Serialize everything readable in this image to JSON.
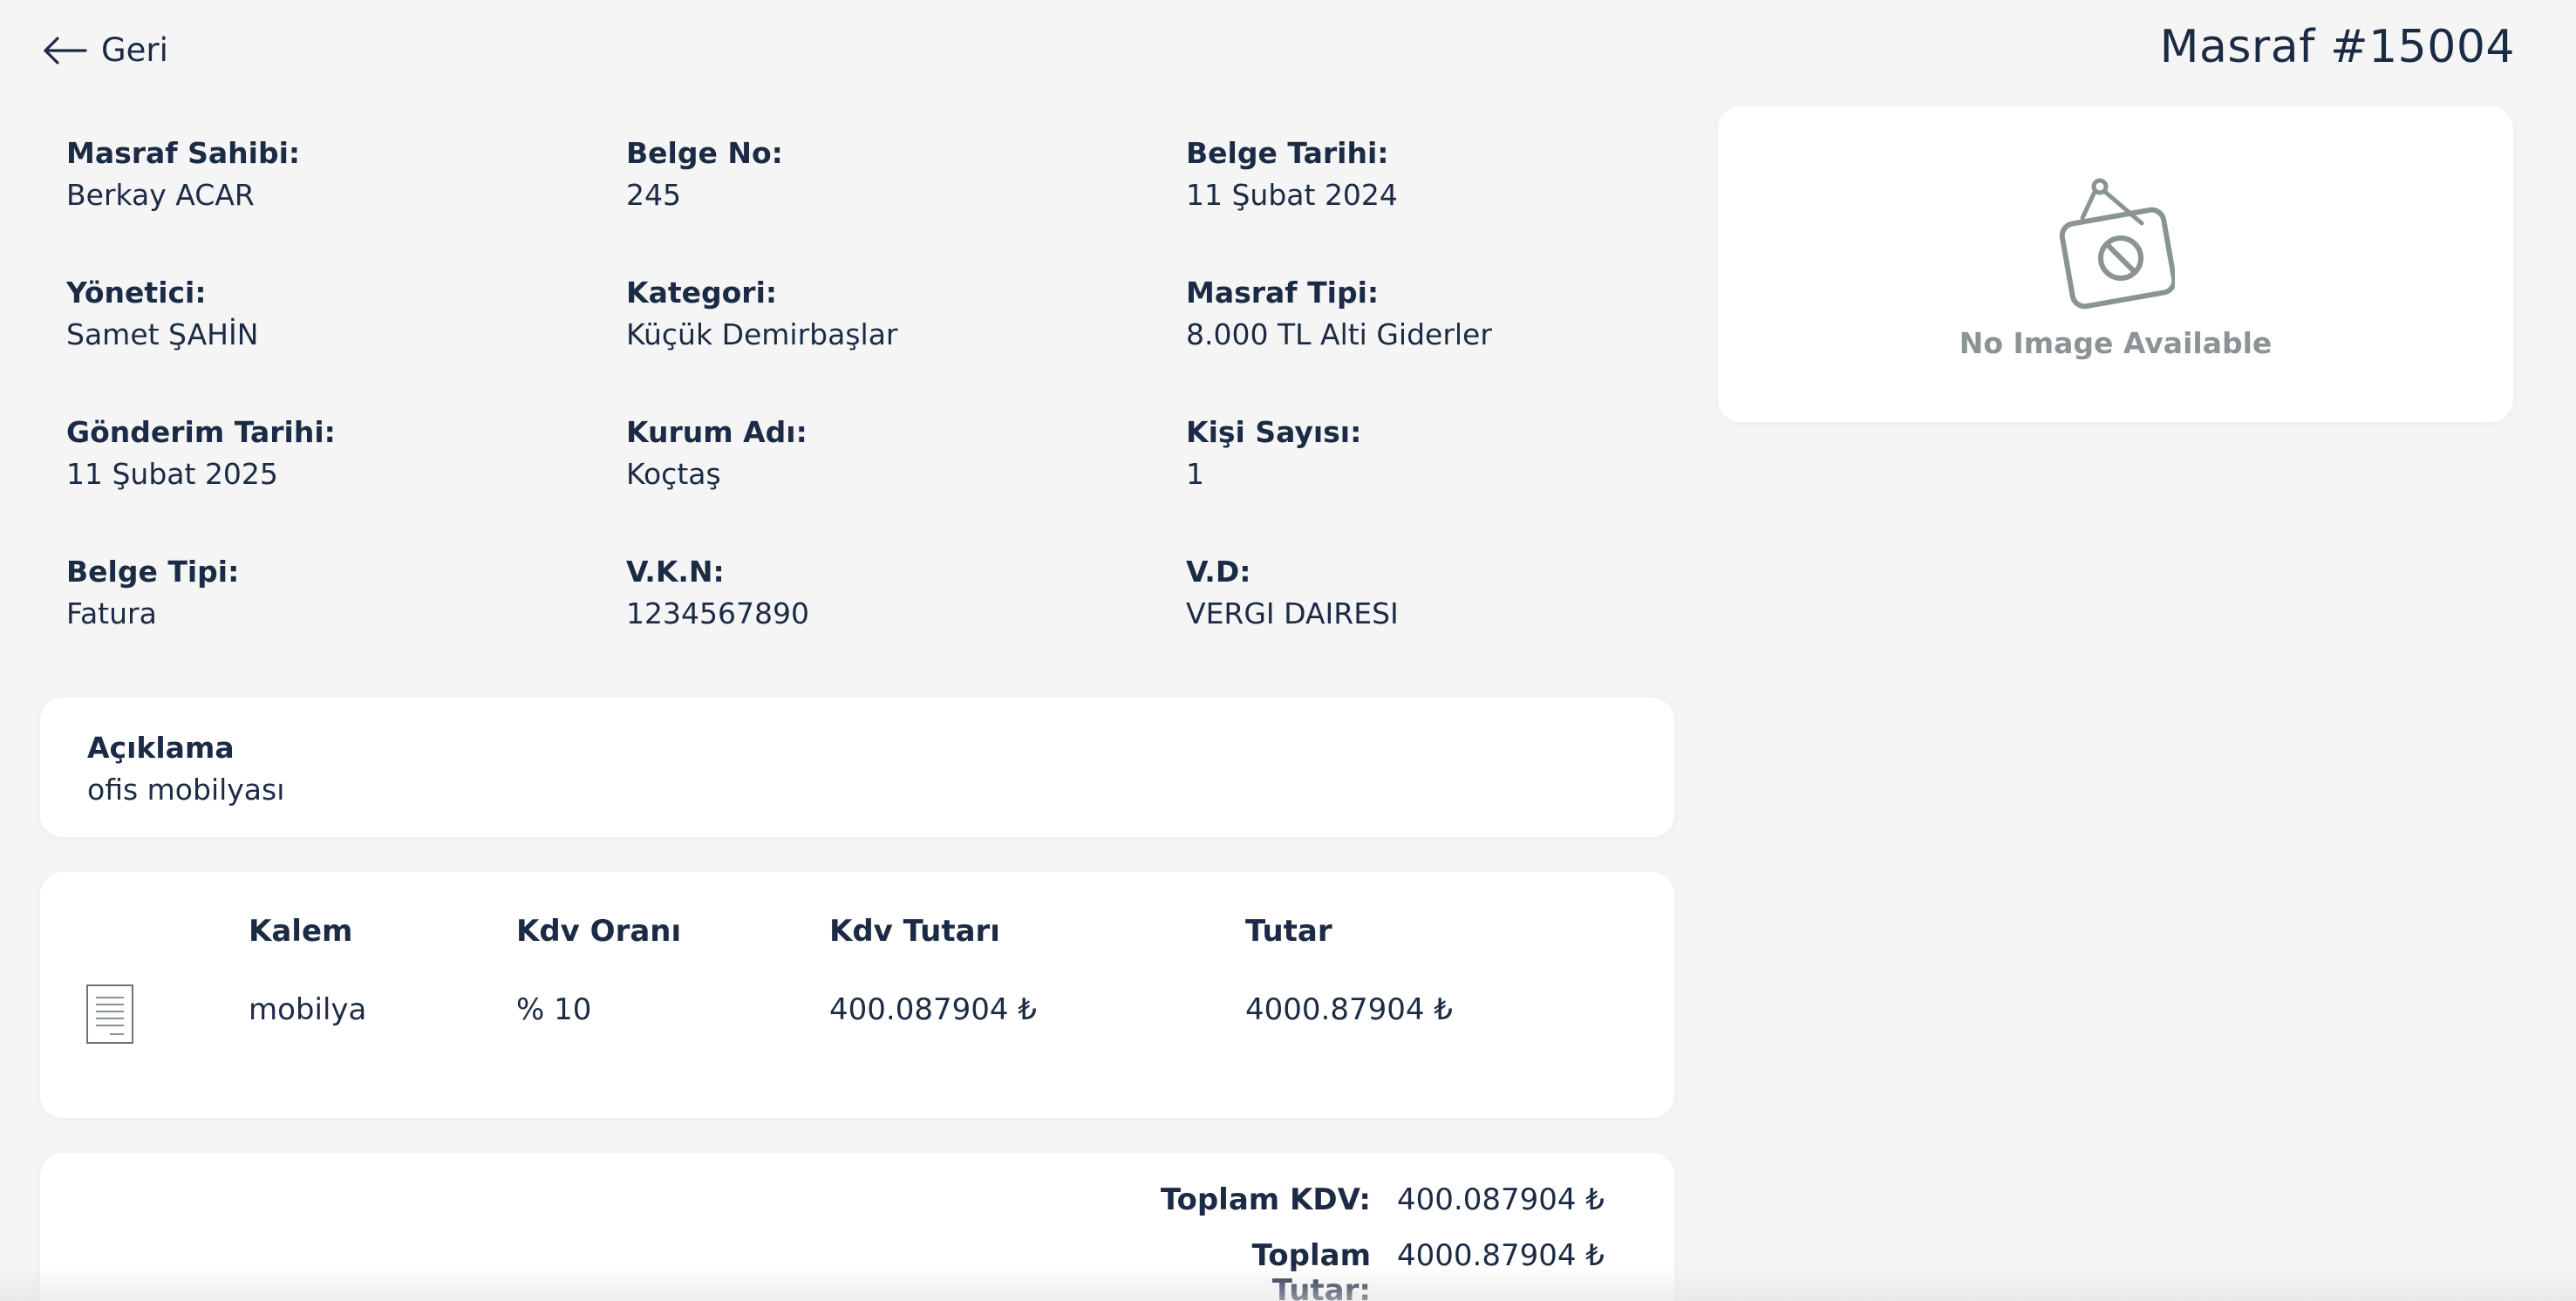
{
  "nav": {
    "back_label": "Geri"
  },
  "header": {
    "title": "Masraf #15004"
  },
  "details": [
    {
      "label": "Masraf Sahibi:",
      "value": "Berkay ACAR"
    },
    {
      "label": "Belge No:",
      "value": "245"
    },
    {
      "label": "Belge Tarihi:",
      "value": "11 Şubat 2024"
    },
    {
      "label": "Yönetici:",
      "value": "Samet ŞAHİN"
    },
    {
      "label": "Kategori:",
      "value": "Küçük Demirbaşlar"
    },
    {
      "label": "Masraf Tipi:",
      "value": "8.000 TL Alti Giderler"
    },
    {
      "label": "Gönderim Tarihi:",
      "value": "11 Şubat 2025"
    },
    {
      "label": "Kurum Adı:",
      "value": "Koçtaş"
    },
    {
      "label": "Kişi Sayısı:",
      "value": "1"
    },
    {
      "label": "Belge Tipi:",
      "value": "Fatura"
    },
    {
      "label": "V.K.N:",
      "value": "1234567890"
    },
    {
      "label": "V.D:",
      "value": "VERGI DAIRESI"
    }
  ],
  "image_preview": {
    "placeholder_text": "No Image Available",
    "icon": "no-image-icon"
  },
  "description": {
    "label": "Açıklama",
    "value": "ofis mobilyası"
  },
  "items_table": {
    "headers": [
      "Kalem",
      "Kdv Oranı",
      "Kdv Tutarı",
      "Tutar"
    ],
    "rows": [
      {
        "icon": "document-icon",
        "kalem": "mobilya",
        "kdv_orani": "% 10",
        "kdv_tutari": "400.087904 ₺",
        "tutar": "4000.87904 ₺"
      }
    ]
  },
  "totals": {
    "kdv_label": "Toplam KDV:",
    "kdv_value": "400.087904 ₺",
    "tutar_label": "Toplam Tutar:",
    "tutar_value": "4000.87904 ₺"
  },
  "colors": {
    "text": "#1c2b45",
    "background": "#f5f5f5",
    "card": "#ffffff",
    "muted": "#8a9495"
  }
}
